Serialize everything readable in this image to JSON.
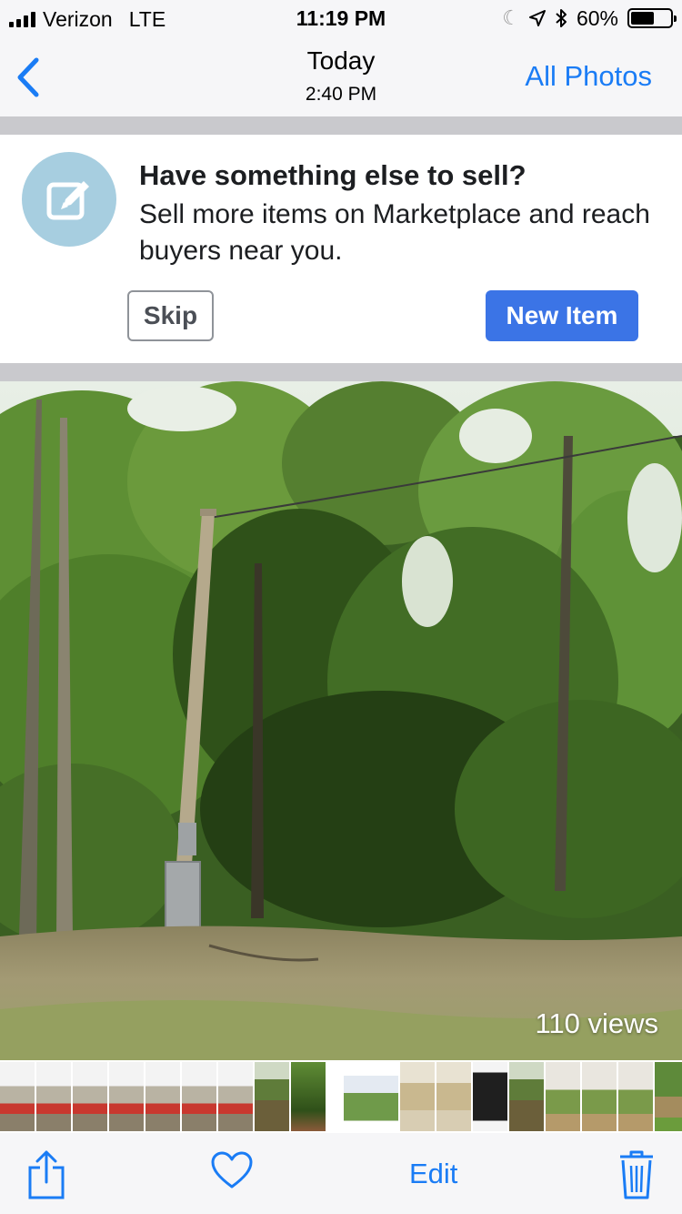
{
  "status_bar": {
    "carrier": "Verizon",
    "network": "LTE",
    "time": "11:19 PM",
    "battery": "60%",
    "battery_level": 0.6
  },
  "nav": {
    "title": "Today",
    "subtitle": "2:40 PM",
    "right_label": "All Photos",
    "back_icon": "chevron-left-icon"
  },
  "promo": {
    "icon": "edit-icon",
    "title": "Have something else to sell?",
    "body": "Sell more items on Marketplace and reach buyers near you.",
    "skip_label": "Skip",
    "new_item_label": "New Item"
  },
  "photo": {
    "views": "110 views"
  },
  "thumbnails": [
    {
      "kind": "patio"
    },
    {
      "kind": "patio"
    },
    {
      "kind": "patio"
    },
    {
      "kind": "patio"
    },
    {
      "kind": "patio"
    },
    {
      "kind": "patio"
    },
    {
      "kind": "patio"
    },
    {
      "kind": "pond"
    },
    {
      "kind": "woods"
    },
    {
      "kind": "screenshot"
    },
    {
      "kind": "document"
    },
    {
      "kind": "document"
    },
    {
      "kind": "dark"
    },
    {
      "kind": "pond"
    },
    {
      "kind": "yard"
    },
    {
      "kind": "yard"
    },
    {
      "kind": "yard"
    },
    {
      "kind": "path"
    }
  ],
  "toolbar": {
    "share_icon": "share-icon",
    "favorite_icon": "heart-icon",
    "edit_label": "Edit",
    "delete_icon": "trash-icon"
  },
  "colors": {
    "accent": "#1a7cf5",
    "button_blue": "#3b74e6",
    "promo_icon_bg": "#a7cee0"
  }
}
